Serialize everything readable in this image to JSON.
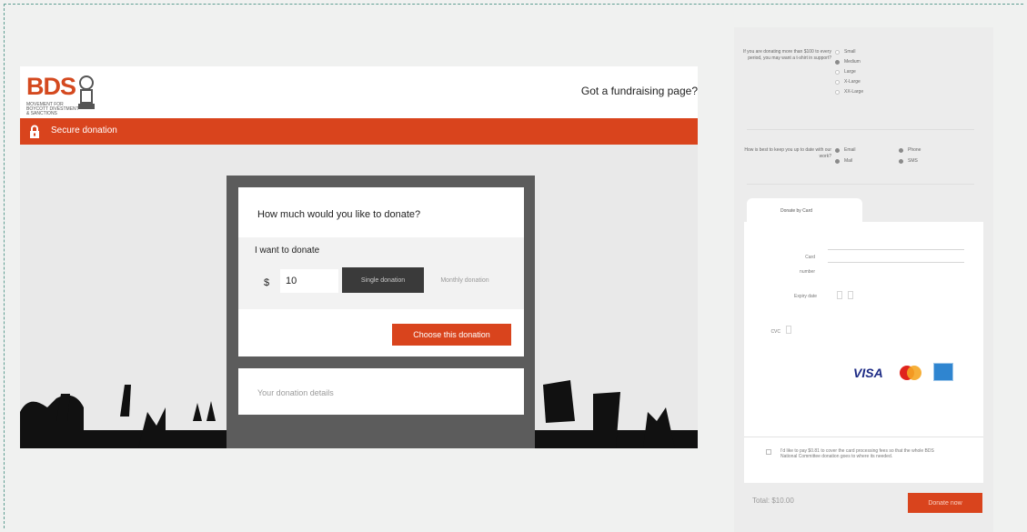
{
  "header": {
    "logo_text": "BDS",
    "logo_subtext": "MOVEMENT FOR BOYCOTT DIVESTMENT & SANCTIONS",
    "fundraise_link": "Got a fundraising page?"
  },
  "secure_bar": {
    "label": "Secure donation"
  },
  "donation_form": {
    "question": "How much would you like to donate?",
    "want_label": "I want to donate",
    "currency": "$",
    "amount": "10",
    "single_label": "Single donation",
    "monthly_label": "Monthly donation",
    "choose_label": "Choose this donation",
    "details_label": "Your donation details"
  },
  "tshirt": {
    "question": "If you are donating more than $100 to every period, you may want a t-shirt in support?",
    "sizes": [
      "Small",
      "Medium",
      "Large",
      "X-Large",
      "XX-Large"
    ],
    "selected": "Medium"
  },
  "contact": {
    "question": "How is best to keep you up to date with our work?",
    "options": [
      "Email",
      "Mail",
      "Phone",
      "SMS"
    ]
  },
  "payment": {
    "tab_label": "Donate by Card",
    "card_label_1": "Card",
    "card_label_2": "number",
    "expiry_label": "Expiry date",
    "cvc_label": "CVC",
    "card_brands": [
      "visa-logo",
      "mastercard-logo",
      "amex-logo"
    ],
    "visa_text": "VISA",
    "fee_text": "I'd like to pay $0.81 to cover the card processing fees so that the whole BDS National Committee donation goes to where its needed."
  },
  "footer": {
    "total": "Total: $10.00",
    "donate_now": "Donate now"
  },
  "colors": {
    "accent": "#d9441d",
    "dark": "#3a3a3a",
    "frame": "#5c5c5c"
  }
}
